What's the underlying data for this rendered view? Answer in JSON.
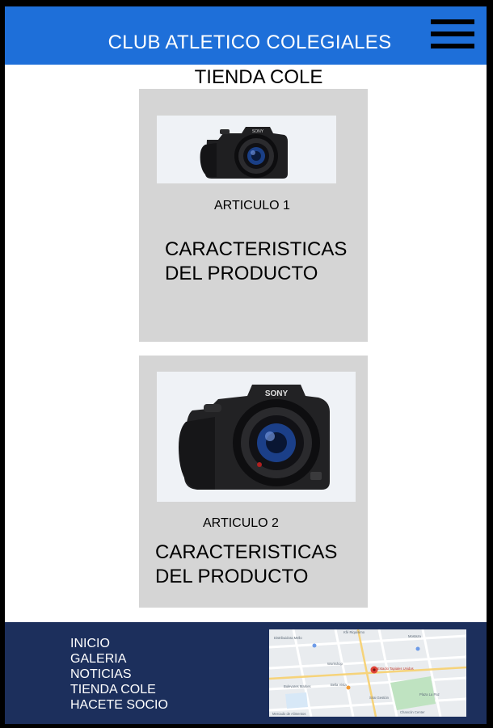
{
  "header": {
    "title": "CLUB ATLETICO COLEGIALES",
    "menu_icon": "hamburger-menu-icon",
    "color": "#1e6fd9"
  },
  "page": {
    "title": "TIENDA COLE"
  },
  "products": [
    {
      "name": "ARTICULO 1",
      "description": "CARACTERISTICAS\nDEL PRODUCTO",
      "image_icon": "camera-image",
      "brand": "SONY"
    },
    {
      "name": "ARTICULO 2",
      "description": "CARACTERISTICAS\nDEL PRODUCTO",
      "image_icon": "camera-image",
      "brand": "SONY"
    }
  ],
  "footer": {
    "color": "#1c2f5c",
    "links": [
      "INICIO",
      "GALERIA",
      "NOTICIAS",
      "TIENDA COLE",
      "HACETE SOCIO"
    ],
    "map": {
      "place": "Estadio Tapiales Unidos",
      "labels": [
        "Distribuidora Mello",
        "Kfé Riquísimo",
        "Mostaza",
        "Workshop",
        "Bella Vista",
        "Bulevares Markes",
        "Sirai Gestión",
        "Chancón Center",
        "Plaza La Paz",
        "Mercado de Alimentos"
      ]
    }
  }
}
